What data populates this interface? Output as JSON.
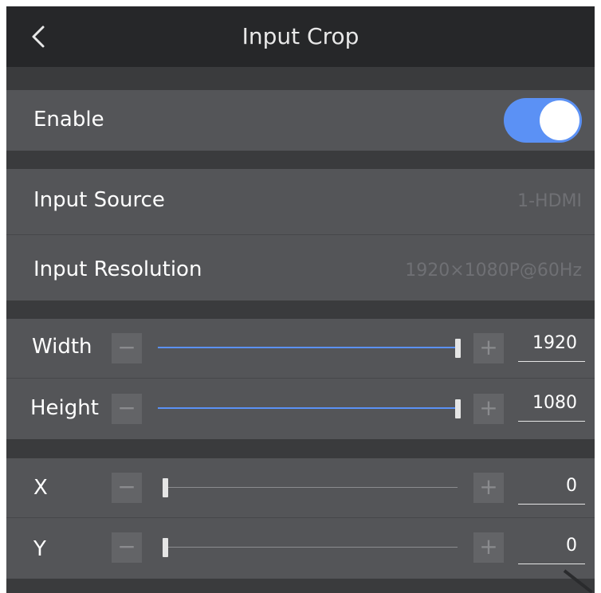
{
  "header": {
    "title": "Input Crop",
    "back_icon": "chevron-left-icon"
  },
  "enable": {
    "label": "Enable",
    "on": true,
    "accent": "#5b91f5"
  },
  "input_source": {
    "label": "Input Source",
    "value": "1-HDMI"
  },
  "input_resolution": {
    "label": "Input Resolution",
    "value": "1920×1080P@60Hz"
  },
  "controls": [
    {
      "label": "Width",
      "value": "1920",
      "level": 1.0,
      "minus": "−",
      "plus": "+"
    },
    {
      "label": "Height",
      "value": "1080",
      "level": 1.0,
      "minus": "−",
      "plus": "+"
    },
    {
      "label": "X",
      "value": "0",
      "level": 0.0,
      "minus": "−",
      "plus": "+"
    },
    {
      "label": "Y",
      "value": "0",
      "level": 0.0,
      "minus": "−",
      "plus": "+"
    }
  ]
}
